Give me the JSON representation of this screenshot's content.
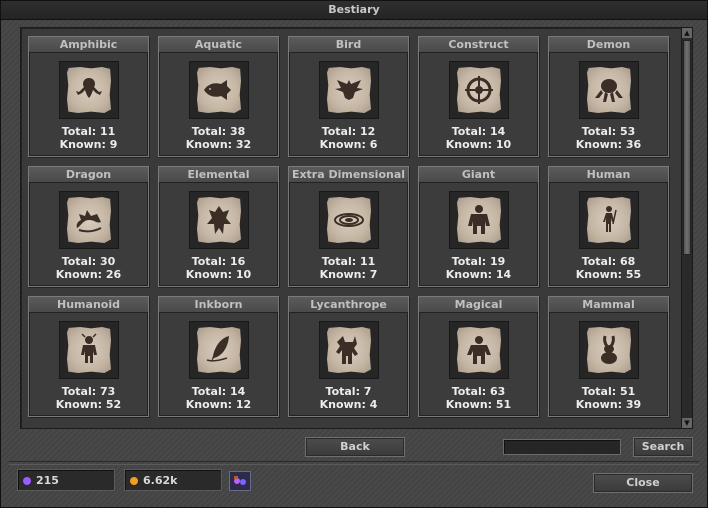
{
  "window": {
    "title": "Bestiary"
  },
  "creatures": [
    {
      "name": "Amphibic",
      "total": "Total: 11",
      "known": "Known: 9",
      "icon": "frog-icon"
    },
    {
      "name": "Aquatic",
      "total": "Total: 38",
      "known": "Known: 32",
      "icon": "fish-icon"
    },
    {
      "name": "Bird",
      "total": "Total: 12",
      "known": "Known: 6",
      "icon": "bird-icon"
    },
    {
      "name": "Construct",
      "total": "Total: 14",
      "known": "Known: 10",
      "icon": "gear-icon"
    },
    {
      "name": "Demon",
      "total": "Total: 53",
      "known": "Known: 36",
      "icon": "demon-icon"
    },
    {
      "name": "Dragon",
      "total": "Total: 30",
      "known": "Known: 26",
      "icon": "dragon-icon"
    },
    {
      "name": "Elemental",
      "total": "Total: 16",
      "known": "Known: 10",
      "icon": "elemental-icon"
    },
    {
      "name": "Extra Dimensional",
      "total": "Total: 11",
      "known": "Known: 7",
      "icon": "vortex-icon"
    },
    {
      "name": "Giant",
      "total": "Total: 19",
      "known": "Known: 14",
      "icon": "giant-icon"
    },
    {
      "name": "Human",
      "total": "Total: 68",
      "known": "Known: 55",
      "icon": "human-icon"
    },
    {
      "name": "Humanoid",
      "total": "Total: 73",
      "known": "Known: 52",
      "icon": "humanoid-icon"
    },
    {
      "name": "Inkborn",
      "total": "Total: 14",
      "known": "Known: 12",
      "icon": "quill-icon"
    },
    {
      "name": "Lycanthrope",
      "total": "Total: 7",
      "known": "Known: 4",
      "icon": "werewolf-icon"
    },
    {
      "name": "Magical",
      "total": "Total: 63",
      "known": "Known: 51",
      "icon": "magical-icon"
    },
    {
      "name": "Mammal",
      "total": "Total: 51",
      "known": "Known: 39",
      "icon": "rabbit-icon"
    }
  ],
  "buttons": {
    "back": "Back",
    "search": "Search",
    "close": "Close"
  },
  "search": {
    "value": ""
  },
  "currencies": {
    "gems": {
      "value": "215",
      "color": "#9a5cff"
    },
    "gold": {
      "value": "6.62k",
      "color": "#f0a020"
    }
  }
}
